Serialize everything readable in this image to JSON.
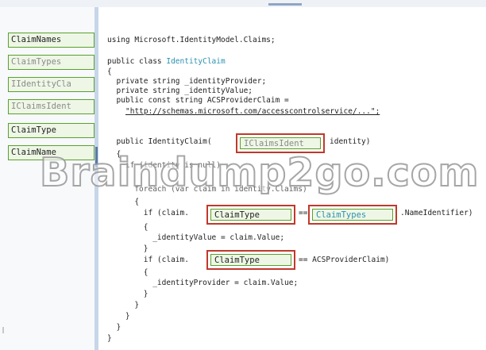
{
  "source_items": [
    {
      "label": "ClaimNames",
      "faded": false
    },
    {
      "label": "ClaimTypes",
      "faded": true
    },
    {
      "label": "IIdentityCla",
      "faded": true
    },
    {
      "label": "IClaimsIdent",
      "faded": true
    },
    {
      "label": "ClaimType",
      "faded": false
    },
    {
      "label": "ClaimName",
      "faded": false
    }
  ],
  "code": {
    "using": "using Microsoft.IdentityModel.Claims;",
    "class_prefix": "public class ",
    "class_name": "IdentityClaim",
    "open_brace": "{",
    "field1": "  private string _identityProvider;",
    "field2": "  private string _identityValue;",
    "const_decl": "  public const string ACSProviderClaim =",
    "const_value": "\"http://schemas.microsoft.com/accesscontrolservice/...\";",
    "ctor_prefix": "  public IdentityClaim(",
    "ctor_suffix": "identity)",
    "ctor_open": "  {",
    "if_null": "    if (identity is null)",
    "foreach": "      foreach (var claim in identity.Claims)",
    "foreach_open": "      {",
    "if1_prefix": "        if (claim.",
    "if1_mid": "==",
    "if1_suffix": ".NameIdentifier)",
    "if1_open": "        {",
    "assign_value": "          _identityValue = claim.Value;",
    "if1_close": "        }",
    "if2_prefix": "        if (claim.",
    "if2_suffix": "== ACSProviderClaim)",
    "if2_open": "        {",
    "assign_provider": "          _identityProvider = claim.Value;",
    "if2_close": "        }",
    "foreach_close": "      }",
    "if_null_close": "    }",
    "ctor_close": "  }",
    "class_close": "}"
  },
  "slots": {
    "ctor_param": "IClaimsIdent",
    "if1_left": "ClaimType",
    "if1_right": "ClaimTypes",
    "if2_left": "ClaimType"
  },
  "watermark": "Braindump2go.com",
  "colors": {
    "item_border": "#5aa02c",
    "item_fill": "#eef7e6",
    "slot_border": "#c0392b",
    "type_name": "#2b91af",
    "divider": "#c7d6e9"
  }
}
